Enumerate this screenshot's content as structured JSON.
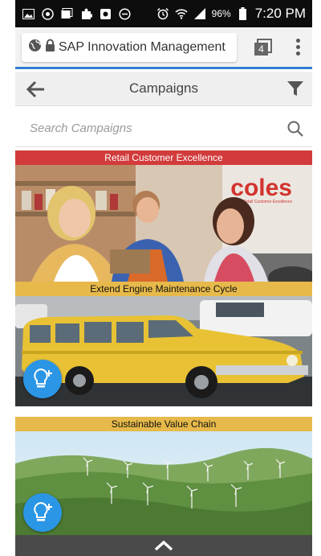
{
  "status_bar": {
    "battery": "96%",
    "time": "7:20 PM"
  },
  "browser": {
    "url_text": "SAP Innovation Management",
    "tab_count": "4"
  },
  "header": {
    "title": "Campaigns"
  },
  "search": {
    "placeholder": "Search Campaigns"
  },
  "campaigns": [
    {
      "title": "Retail Customer Excellence",
      "brand_logo": "coles",
      "brand_tagline": "Retail Customer Excellence",
      "title_color": "#d23b3b"
    },
    {
      "title": "Extend Engine Maintenance Cycle",
      "title_color": "#e6b94a"
    },
    {
      "title": "Sustainable Value Chain",
      "title_color": "#e6b94a"
    }
  ],
  "colors": {
    "accent": "#2f7fd3",
    "idea_button": "#2b96e5"
  }
}
